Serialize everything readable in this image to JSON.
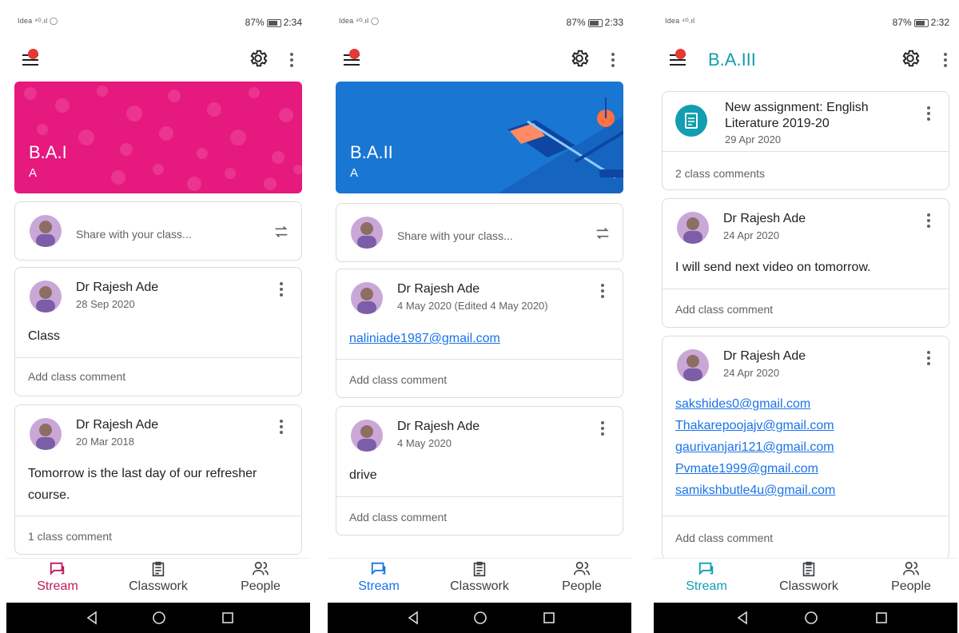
{
  "screens": [
    {
      "status": {
        "carrier": "Idea ⁴ᴳ.ıl ◯",
        "battery": "87%",
        "time": "2:34"
      },
      "class_title": "",
      "banner": {
        "title": "B.A.I",
        "section": "A",
        "color": "#e5197e"
      },
      "share_placeholder": "Share with your class...",
      "posts": [
        {
          "author": "Dr Rajesh Ade",
          "date": "28 Sep 2020",
          "body": "Class",
          "comment": "Add class comment"
        },
        {
          "author": "Dr Rajesh Ade",
          "date": "20 Mar 2018",
          "body": "Tomorrow is the last day of our refresher course.",
          "comment": "1 class comment"
        }
      ],
      "nav": {
        "stream": "Stream",
        "classwork": "Classwork",
        "people": "People",
        "active_color": "#c2185b"
      }
    },
    {
      "status": {
        "carrier": "Idea ⁴ᴳ.ıl ◯",
        "battery": "87%",
        "time": "2:33"
      },
      "class_title": "",
      "banner": {
        "title": "B.A.II",
        "section": "A",
        "color": "#1976d2"
      },
      "share_placeholder": "Share with your class...",
      "posts": [
        {
          "author": "Dr Rajesh Ade",
          "date": "4 May 2020 (Edited 4 May 2020)",
          "link": "naliniade1987@gmail.com",
          "comment": "Add class comment"
        },
        {
          "author": "Dr Rajesh Ade",
          "date": "4 May 2020",
          "body": "drive",
          "comment": "Add class comment"
        }
      ],
      "nav": {
        "stream": "Stream",
        "classwork": "Classwork",
        "people": "People",
        "active_color": "#1a73e8"
      }
    },
    {
      "status": {
        "carrier": "Idea ⁴ᴳ.ıl",
        "battery": "87%",
        "time": "2:32"
      },
      "class_title": "B.A.III",
      "assignment": {
        "title_line1": "New assignment: English",
        "title_line2": "Literature 2019-20",
        "date": "29 Apr 2020",
        "comment": "2 class comments"
      },
      "posts": [
        {
          "author": "Dr Rajesh Ade",
          "date": "24 Apr 2020",
          "body": "I will send next video on tomorrow.",
          "comment": "Add class comment"
        },
        {
          "author": "Dr Rajesh Ade",
          "date": "24 Apr 2020",
          "links": [
            "sakshides0@gmail.com",
            "Thakarepoojajv@gmail.com",
            "gaurivanjari121@gmail.com",
            "Pvmate1999@gmail.com",
            "samikshbutle4u@gmail.com"
          ],
          "comment": "Add class comment"
        }
      ],
      "nav": {
        "stream": "Stream",
        "classwork": "Classwork",
        "people": "People",
        "active_color": "#129eaf"
      }
    }
  ]
}
